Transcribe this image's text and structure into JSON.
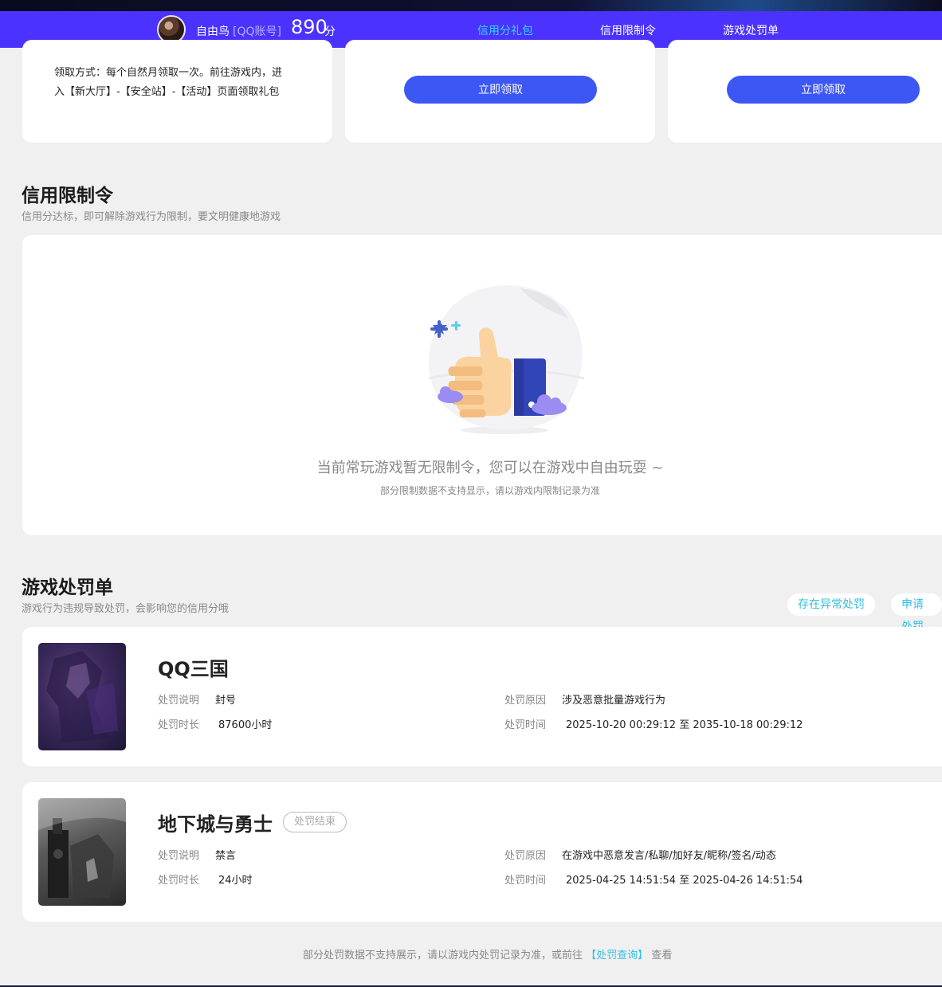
{
  "header": {
    "username": "自由鸟",
    "account_type": "[QQ账号]",
    "score": "890",
    "score_unit": "分",
    "tabs": [
      {
        "label": "信用分礼包",
        "active": true
      },
      {
        "label": "信用限制令",
        "active": false
      },
      {
        "label": "游戏处罚单",
        "active": false
      }
    ],
    "accent_color": "#4b32ff",
    "active_tab_color": "#34d6f0"
  },
  "gift": {
    "desc_line1": "领取方式：每个自然月领取一次。前往游戏内，进",
    "desc_line2": "入【新大厅】-【安全站】-【活动】页面领取礼包",
    "claim_label": "立即领取"
  },
  "restriction": {
    "title": "信用限制令",
    "subtitle": "信用分达标，即可解除游戏行为限制，要文明健康地游戏",
    "empty_icon": "thumbs-up-icon",
    "empty_message": "当前常玩游戏暂无限制令，您可以在游戏中自由玩耍 ~",
    "empty_note": "部分限制数据不支持显示，请以游戏内限制记录为准"
  },
  "penalty": {
    "title": "游戏处罚单",
    "subtitle": "游戏行为违规导致处罚，会影响您的信用分哦",
    "abnormal_label": "存在异常处罚",
    "appeal_label": "申请处罚",
    "labels": {
      "desc": "处罚说明",
      "duration": "处罚时长",
      "reason": "处罚原因",
      "time": "处罚时间"
    },
    "items": [
      {
        "game": "QQ三国",
        "status": "",
        "desc": "封号",
        "duration": "87600小时",
        "reason": "涉及恶意批量游戏行为",
        "time": "2025-10-20 00:29:12 至 2035-10-18 00:29:12"
      },
      {
        "game": "地下城与勇士",
        "status": "处罚结束",
        "desc": "禁言",
        "duration": "24小时",
        "reason": "在游戏中恶意发言/私聊/加好友/昵称/签名/动态",
        "time": "2025-04-25 14:51:54 至 2025-04-26 14:51:54"
      }
    ],
    "footer_prefix": "部分处罚数据不支持展示，请以游戏内处罚记录为准，或前往",
    "footer_link": "【处罚查询】",
    "footer_suffix": "查看"
  }
}
